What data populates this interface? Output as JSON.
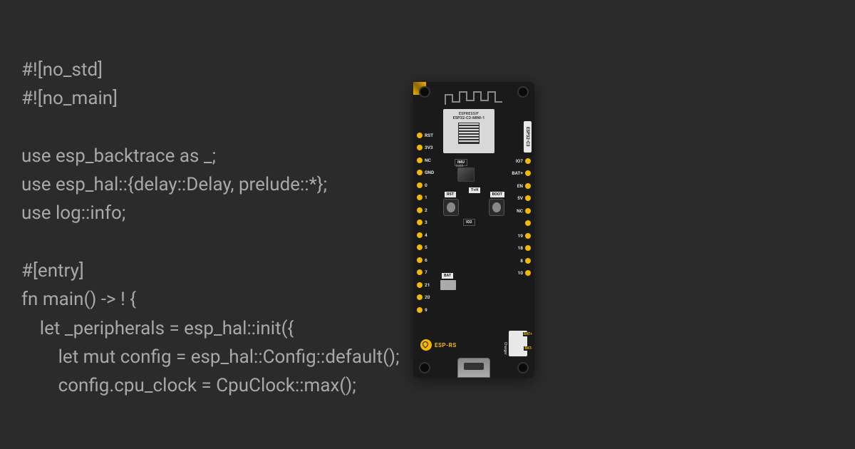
{
  "code": {
    "lines": [
      "#![no_std]",
      "#![no_main]",
      "",
      "use esp_backtrace as _;",
      "use esp_hal::{delay::Delay, prelude::*};",
      "use log::info;",
      "",
      "#[entry]",
      "fn main() -> ! {",
      "    let _peripherals = esp_hal::init({",
      "        let mut config = esp_hal::Config::default();",
      "        config.cpu_clock = CpuClock::max();"
    ]
  },
  "board": {
    "module_brand": "ESPRESSIF",
    "module_name": "ESP32-C3-MINI-1",
    "side_label": "ESP32-C3",
    "logo_text": "ESP-RS",
    "pins_left": [
      "RST",
      "3V3",
      "NC",
      "GND",
      "0",
      "1",
      "2",
      "3",
      "4",
      "5",
      "6",
      "7",
      "21",
      "20",
      "9"
    ],
    "pins_right": [
      "IO7",
      "BAT+",
      "EN",
      "5V",
      "NC",
      "",
      "19",
      "18",
      "8",
      "10"
    ],
    "labels": {
      "imu": "IMU",
      "imu_addr": "0x68",
      "rst_btn": "RST",
      "boot_btn": "BOOT",
      "th": "T+H",
      "io2": "IO2",
      "bat": "BAT",
      "charger": "Charger",
      "bat_plus": "BAT+",
      "bat_minus": "BAT-"
    }
  }
}
